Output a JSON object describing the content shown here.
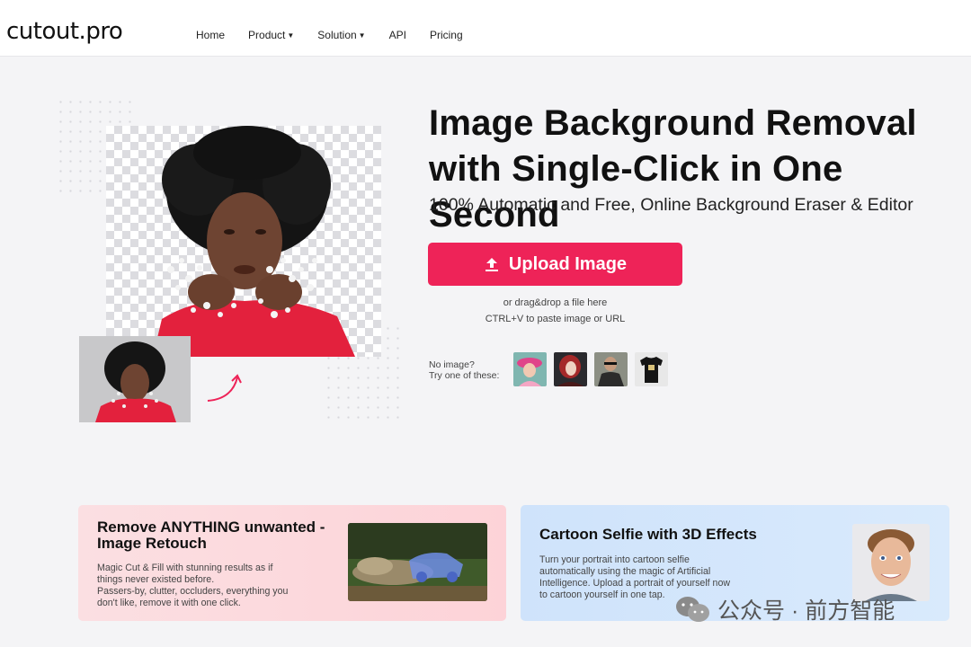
{
  "header": {
    "logo": "cutout.pro",
    "nav": [
      {
        "label": "Home",
        "dropdown": false
      },
      {
        "label": "Product",
        "dropdown": true
      },
      {
        "label": "Solution",
        "dropdown": true
      },
      {
        "label": "API",
        "dropdown": false
      },
      {
        "label": "Pricing",
        "dropdown": false
      }
    ]
  },
  "hero": {
    "title_line1": "Image Background Removal",
    "title_line2": "with Single-Click in One Second",
    "subtitle": "100% Automatic and Free, Online Background Eraser & Editor",
    "upload_label": "Upload Image",
    "hint_drag": "or drag&drop a file here",
    "hint_paste": "CTRL+V to paste image or URL",
    "try_line1": "No image?",
    "try_line2": "Try one of these:",
    "samples": [
      "girl-pink-hat",
      "woman-red-hair",
      "man-sunglasses",
      "black-tshirt"
    ]
  },
  "cards": [
    {
      "title": "Remove ANYTHING unwanted - Image Retouch",
      "desc_line1": "Magic Cut & Fill with stunning results as if",
      "desc_line2": "things never existed before.",
      "desc_line3": "Passers-by, clutter, occluders, everything you",
      "desc_line4": "don't like, remove it with one click."
    },
    {
      "title": "Cartoon Selfie with 3D Effects",
      "desc_line1": "Turn your portrait into cartoon selfie",
      "desc_line2": "automatically using the magic of Artificial",
      "desc_line3": "Intelligence. Upload a portrait of yourself now",
      "desc_line4": "to cartoon yourself in one tap."
    }
  ],
  "watermark": "公众号 · 前方智能",
  "colors": {
    "accent": "#ee2358",
    "card_red": "#fdd3d8",
    "card_blue": "#cfe3fb"
  }
}
